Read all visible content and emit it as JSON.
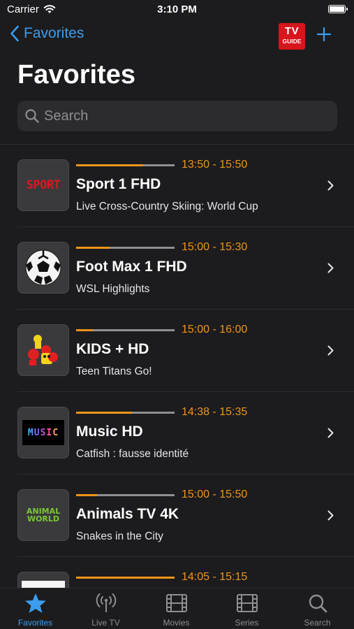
{
  "status_bar": {
    "carrier": "Carrier",
    "time": "3:10 PM"
  },
  "nav": {
    "back_label": "Favorites",
    "tv_text": "TV",
    "guide_text": "GUIDE"
  },
  "title": "Favorites",
  "search": {
    "placeholder": "Search"
  },
  "channels": [
    {
      "name": "Sport 1 FHD",
      "time": "13:50 - 15:50",
      "program": "Live Cross-Country Skiing: World Cup",
      "logo_text": "SPORT",
      "progress": 0.68
    },
    {
      "name": "Foot Max 1 FHD",
      "time": "15:00 - 15:30",
      "program": "WSL Highlights",
      "logo_text": "",
      "progress": 0.34
    },
    {
      "name": "KIDS + HD",
      "time": "15:00 - 16:00",
      "program": "Teen Titans Go!",
      "logo_text": "",
      "progress": 0.17
    },
    {
      "name": "Music HD",
      "time": "14:38 - 15:35",
      "program": "Catfish : fausse identité",
      "logo_text": "MUSIC",
      "progress": 0.57
    },
    {
      "name": "Animals TV 4K",
      "time": "15:00 - 15:50",
      "program": "Snakes in the City",
      "logo_text": "ANIMAL WORLD",
      "progress": 0.21
    },
    {
      "name": "",
      "time": "14:05 - 15:15",
      "program": "",
      "logo_text": "",
      "progress": 1.0
    }
  ],
  "tabs": [
    {
      "label": "Favorites",
      "icon": "star-icon",
      "active": true
    },
    {
      "label": "Live TV",
      "icon": "antenna-icon",
      "active": false
    },
    {
      "label": "Movies",
      "icon": "film-icon",
      "active": false
    },
    {
      "label": "Series",
      "icon": "film-icon",
      "active": false
    },
    {
      "label": "Search",
      "icon": "search-icon",
      "active": false
    }
  ],
  "colors": {
    "accent": "#3a9df0",
    "orange": "#f0941a",
    "background": "#1c1c1e"
  }
}
